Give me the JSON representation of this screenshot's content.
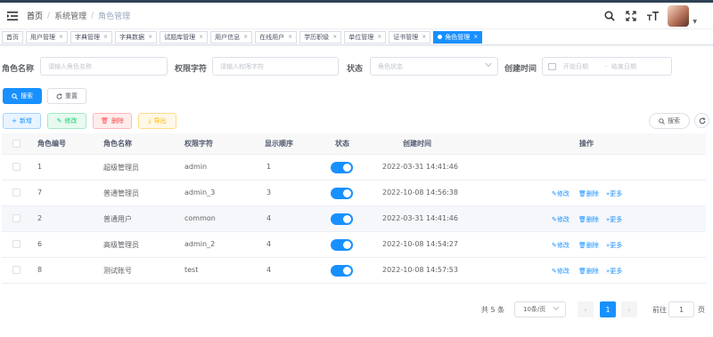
{
  "navbar": {
    "breadcrumb": [
      "首页",
      "系统管理",
      "角色管理"
    ],
    "icons": [
      "hamburger-icon",
      "search-icon",
      "fullscreen-icon",
      "font-size-icon",
      "avatar"
    ]
  },
  "tags": [
    {
      "label": "首页",
      "closable": false,
      "active": false
    },
    {
      "label": "用户管理",
      "closable": true,
      "active": false
    },
    {
      "label": "字典管理",
      "closable": true,
      "active": false
    },
    {
      "label": "字典数据",
      "closable": true,
      "active": false
    },
    {
      "label": "试题库管理",
      "closable": true,
      "active": false
    },
    {
      "label": "用户信息",
      "closable": true,
      "active": false
    },
    {
      "label": "在线用户",
      "closable": true,
      "active": false
    },
    {
      "label": "学历职级",
      "closable": true,
      "active": false
    },
    {
      "label": "单位管理",
      "closable": true,
      "active": false
    },
    {
      "label": "证书管理",
      "closable": true,
      "active": false
    },
    {
      "label": "角色管理",
      "closable": true,
      "active": true
    }
  ],
  "search": {
    "role_name_label": "角色名称",
    "role_name_placeholder": "请输入角色名称",
    "role_key_label": "权限字符",
    "role_key_placeholder": "请输入权限字符",
    "status_label": "状态",
    "status_placeholder": "角色状态",
    "created_label": "创建时间",
    "start_placeholder": "开始日期",
    "range_sep": "-",
    "end_placeholder": "结束日期",
    "search_btn": "搜索",
    "reset_btn": "重置"
  },
  "toolbar": {
    "add": "新增",
    "edit": "修改",
    "delete": "删除",
    "export": "导出",
    "search_toggle": "搜索"
  },
  "table": {
    "headers": [
      "角色编号",
      "角色名称",
      "权限字符",
      "显示顺序",
      "状态",
      "创建时间",
      "操作"
    ],
    "rows": [
      {
        "id": "1",
        "name": "超级管理员",
        "key": "admin",
        "order": "1",
        "status": true,
        "created": "2022-03-31 14:41:46",
        "ops": false
      },
      {
        "id": "7",
        "name": "普通管理员",
        "key": "admin_3",
        "order": "3",
        "status": true,
        "created": "2022-10-08 14:56:38",
        "ops": true
      },
      {
        "id": "2",
        "name": "普通用户",
        "key": "common",
        "order": "4",
        "status": true,
        "created": "2022-03-31 14:41:46",
        "ops": true
      },
      {
        "id": "6",
        "name": "高级管理员",
        "key": "admin_2",
        "order": "4",
        "status": true,
        "created": "2022-10-08 14:54:27",
        "ops": true
      },
      {
        "id": "8",
        "name": "测试账号",
        "key": "test",
        "order": "4",
        "status": true,
        "created": "2022-10-08 14:57:53",
        "ops": true
      }
    ],
    "op_labels": {
      "edit": "修改",
      "delete": "删除",
      "more": "更多"
    }
  },
  "pagination": {
    "total": "共 5 条",
    "page_size": "10条/页",
    "current_page": "1",
    "goto_label": "前往",
    "goto_value": "1",
    "page_suffix": "页"
  },
  "colors": {
    "primary": "#1890ff",
    "sidebar": "#304156"
  }
}
